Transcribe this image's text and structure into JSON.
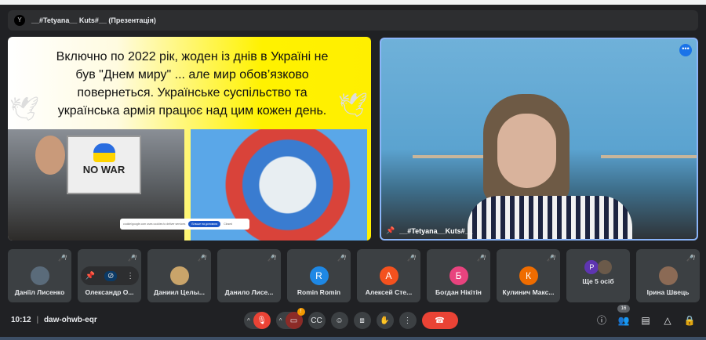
{
  "header": {
    "title": "__#Tetyana__ Kuts#__ (Презентація)"
  },
  "slide": {
    "lines": [
      "Включно по 2022 рік, жоден із днів в Україні не",
      "був \"Днем миру\" ... але мир обов’язково",
      "повернеться. Українське суспільство та",
      "українська армія працює над цим кожен день."
    ],
    "sign_text": "NO   WAR",
    "cookie_text": "cookie/google.com uses cookies to deliver services",
    "cookie_button": "Більше на допомога",
    "cookie_close": "Closed"
  },
  "video": {
    "name": "__#Tetyana__Kuts#__"
  },
  "participants": [
    {
      "name": "Даніїл Лисенко",
      "avatar": "photo",
      "color": "#5a6b7a"
    },
    {
      "name": "Олександр О...",
      "avatar": "hover"
    },
    {
      "name": "Даниил Целы...",
      "avatar": "photo",
      "color": "#c9a46a"
    },
    {
      "name": "Данило Лисе...",
      "avatar": "none"
    },
    {
      "name": "Romin Romin",
      "initial": "R",
      "color": "#1e88e5"
    },
    {
      "name": "Алексей Сте...",
      "initial": "А",
      "color": "#f4511e"
    },
    {
      "name": "Богдан Нікітін",
      "initial": "Б",
      "color": "#e8437e"
    },
    {
      "name": "Кулинич Макс...",
      "initial": "К",
      "color": "#ef6c00"
    },
    {
      "name": "Ще 5 осіб",
      "initial": "P",
      "color": "#5e35b1"
    },
    {
      "name": "Ірина Швець",
      "avatar": "photo",
      "color": "#8b6a55"
    }
  ],
  "bottom": {
    "time": "10:12",
    "separator": "|",
    "meeting_code": "daw-ohwb-eqr",
    "camera_badge": "!",
    "people_count": "16"
  }
}
